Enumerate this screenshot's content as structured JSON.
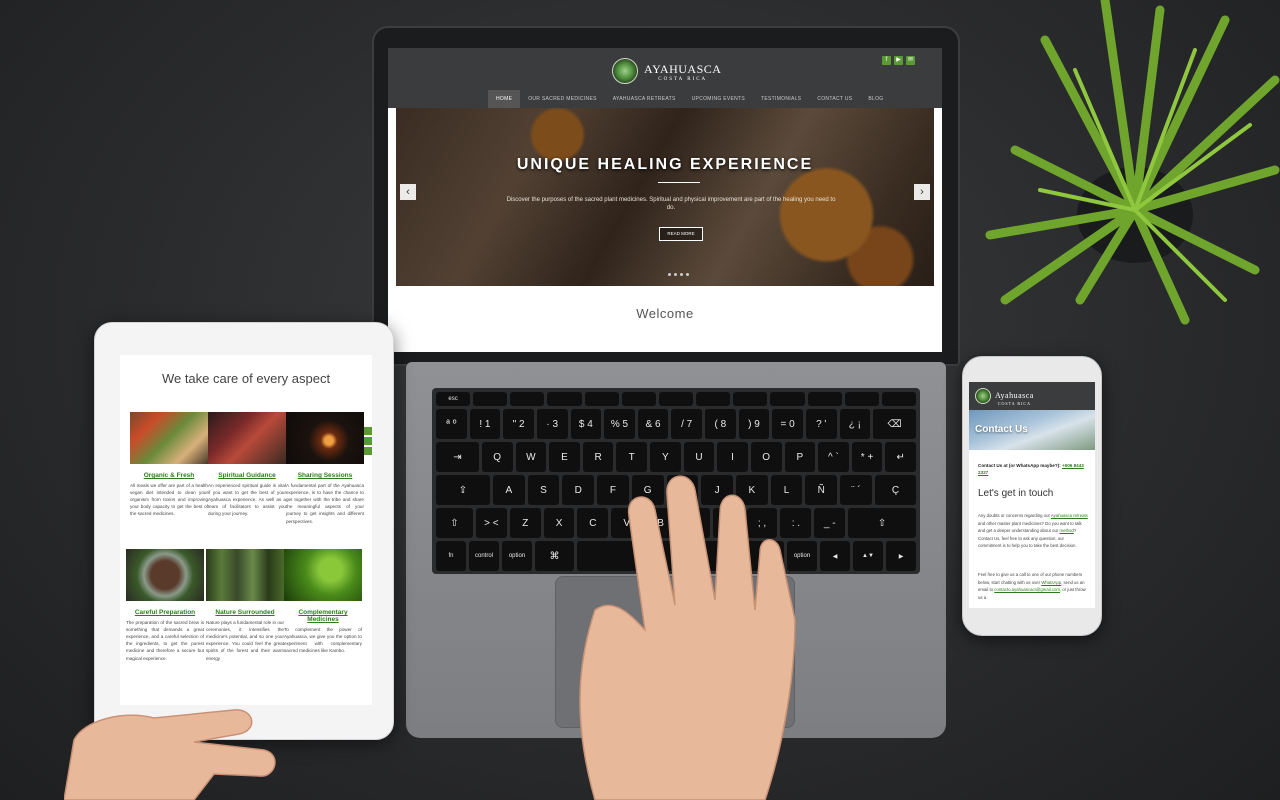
{
  "laptop_site": {
    "logo_title": "AYAHUASCA",
    "logo_subtitle": "COSTA RICA",
    "social": [
      "f",
      "▶",
      "✉"
    ],
    "nav": [
      "HOME",
      "OUR SACRED MEDICINES",
      "AYAHUASCA RETREATS",
      "UPCOMING EVENTS",
      "TESTIMONIALS",
      "CONTACT US",
      "BLOG"
    ],
    "hero_title": "UNIQUE HEALING EXPERIENCE",
    "hero_subtitle": "Discover the purposes of the sacred plant medicines. Spiritual and physical improvement are part of the healing you need to do.",
    "hero_button": "READ MORE",
    "arrow_left": "‹",
    "arrow_right": "›",
    "welcome": "Welcome"
  },
  "keyboard": {
    "fn_row": [
      "esc",
      "",
      "",
      "",
      "",
      "",
      "",
      "",
      "",
      "",
      "",
      "",
      ""
    ],
    "row1": [
      "ª º",
      "! 1",
      "\" 2",
      "· 3",
      "$ 4",
      "% 5",
      "& 6",
      "/ 7",
      "( 8",
      ") 9",
      "= 0",
      "? '",
      "¿ ¡",
      "⌫"
    ],
    "row2": [
      "⇥",
      "Q",
      "W",
      "E",
      "R",
      "T",
      "Y",
      "U",
      "I",
      "O",
      "P",
      "^ `",
      "* +",
      "↵"
    ],
    "row3": [
      "⇪",
      "A",
      "S",
      "D",
      "F",
      "G",
      "H",
      "J",
      "K",
      "L",
      "Ñ",
      "¨ ´",
      "Ç"
    ],
    "row4": [
      "⇧",
      "> <",
      "Z",
      "X",
      "C",
      "V",
      "B",
      "N",
      "M",
      "; ,",
      ": .",
      "_ -",
      "⇧"
    ],
    "row5": [
      "fn",
      "control",
      "option",
      "⌘",
      "",
      "⌘",
      "option",
      "◀",
      "▲▼",
      "▶"
    ]
  },
  "tablet_site": {
    "heading": "We take care of every aspect",
    "items": [
      {
        "title": "Organic & Fresh",
        "text": "All meals we offer are part of a health vegan diet intended to clean your organism from toxins and improving your body capacity to get the best of the sacred medicines."
      },
      {
        "title": "Spiritual Guidance",
        "text": "An experienced spiritual guide is vital if you want to get the best of your Ayahuasca experience. As well as a team of facilitators to assist you during your journey."
      },
      {
        "title": "Sharing Sessions",
        "text": "A fundamental part of the Ayahuasca experience, is to have the chance to get together with the tribe and share the meaningful aspects of your journey to get insights and different perspectives."
      },
      {
        "title": "Careful Preparation",
        "text": "The preparation of the sacred brew is something that demands a great experience, and a careful selection of the ingredients, to get the purest medicine and therefore a secure but magical experience."
      },
      {
        "title": "Nature Surrounded",
        "text": "Nature plays a fundamental role in our ceremonies, it intensifies the medicine's potential, and so one your experience. You could feel the great spirits of the forest and their warm energy"
      },
      {
        "title": "Complementary Medicines",
        "text": "To complement the power of Ayahuasca, we give you the option to experiment with complementary sacred medicines like Kambo."
      }
    ]
  },
  "phone_site": {
    "logo_title": "Ayahuasca",
    "logo_subtitle": "COSTA RICA",
    "hero_title": "Contact Us",
    "contact_label": "Contact Us at (or WhatsApp maybe?):",
    "contact_phone": "+506 8443 2327",
    "touch_heading": "Let's get in touch",
    "para1_a": "Any doubts or concerns regarding our",
    "para1_link1": "Ayahuasca retreats",
    "para1_b": "and other master plant medicines? Do you want to talk and get a deeper understanding about our",
    "para1_link2": "method",
    "para1_c": "? Contact Us, feel free to ask any question, our commitment is to help you to take the best decision.",
    "para2_a": "Feel free to give us a call to one of our phone numbers below, start chatting with us over",
    "para2_link1": "WhatsApp",
    "para2_b": ", send us an email to",
    "para2_link2": "contacto.ayahuascacr@gmail.com",
    "para2_c": ", or just throw us a"
  }
}
